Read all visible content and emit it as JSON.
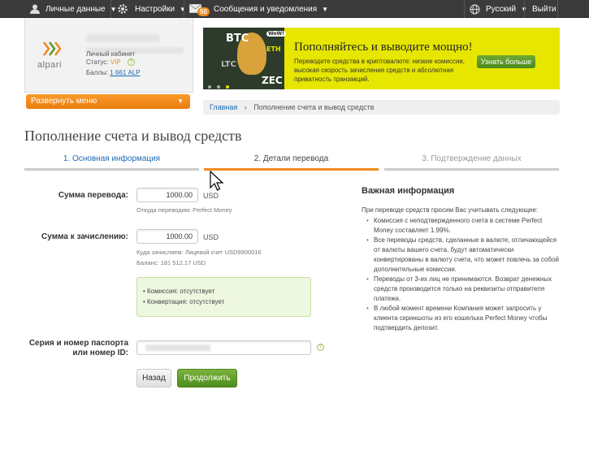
{
  "topbar": {
    "personal_label": "Личные данные",
    "settings_label": "Настройки",
    "messages_label": "Сообщения и уведомления",
    "messages_badge": "50",
    "language_label": "Русский",
    "logout_label": "Выйти"
  },
  "profile": {
    "logo_text": "alpari",
    "cabinet_label": "Личный кабинет",
    "status_label": "Статус:",
    "status_value": "VIP",
    "points_label": "Баллы:",
    "points_value": "1 661 ALP",
    "menu_button": "Развернуть меню"
  },
  "banner": {
    "coins": [
      "BTC",
      "ETH",
      "LTC",
      "ZEC"
    ],
    "wow": "WoW!",
    "title": "Пополняйтесь и выводите мощно!",
    "description": "Переводите средства в криптовалюте: низкие комиссии, высокая скорость зачисления средств и абсолютная приватность транзакций.",
    "button": "Узнать больше"
  },
  "breadcrumb": {
    "home": "Главная",
    "separator": "›",
    "current": "Пополнение счета и вывод средств"
  },
  "page_title": "Пополнение счета и вывод средств",
  "steps": [
    {
      "label": "1. Основная информация"
    },
    {
      "label": "2. Детали перевода"
    },
    {
      "label": "3. Подтверждение данных"
    }
  ],
  "form": {
    "amount_label": "Сумма перевода:",
    "amount_value": "1000.00",
    "amount_currency": "USD",
    "amount_hint": "Откуда переводим: Perfect Money",
    "credit_label": "Сумма к зачислению:",
    "credit_value": "1000.00",
    "credit_currency": "USD",
    "credit_hint_1": "Куда зачисляем:  Лицевой счет USD9900016",
    "credit_hint_2": "Баланс: 181 512.17 USD",
    "commission": "• Комиссия: отсутствует",
    "conversion": "• Конвертация: отсутствует",
    "passport_label_1": "Серия и номер паспорта",
    "passport_label_2": "или номер ID:",
    "back_button": "Назад",
    "continue_button": "Продолжить"
  },
  "important": {
    "title": "Важная информация",
    "intro": "При переводе средств просим Вас учитывать следующее:",
    "items": [
      "Комиссия с неподтвержденного счета в системе Perfect Money составляет 1.99%.",
      "Все переводы средств, сделанные в валюте, отличающейся от валюты вашего счета, будут автоматически конвертированы в валюту счета, что может повлечь за собой дополнительные комиссии.",
      "Переводы от 3-их лиц не принимаются. Возврат денежных средств производится только на реквизиты отправителя платежа.",
      "В любой момент времени Компания может запросить у клиента скриншоты из его кошелька Perfect Money чтобы подтвердить депозит."
    ]
  },
  "colors": {
    "accent": "#f08a1e",
    "link": "#1a6ab5",
    "green": "#5a9a26",
    "banner_bg": "#e6e600"
  }
}
